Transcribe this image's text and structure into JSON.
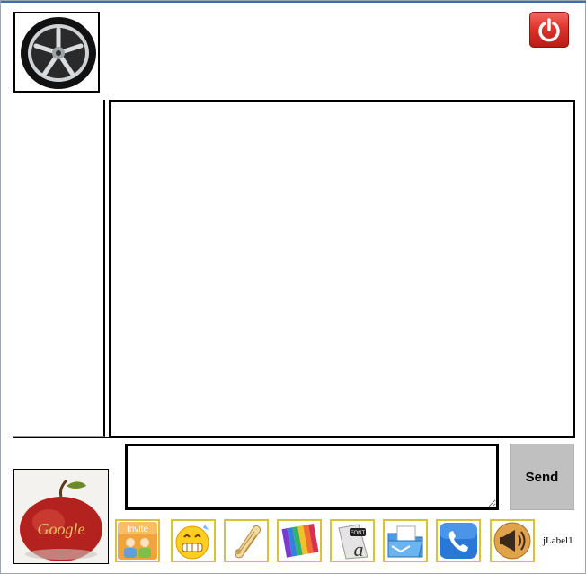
{
  "header": {
    "power_icon": "power-icon"
  },
  "compose": {
    "message_value": "",
    "send_label": "Send"
  },
  "toolbar": {
    "invite_label": "Invite",
    "font_badge": "FONT",
    "font_letter": "a",
    "icons": [
      "invite-icon",
      "emoticon-icon",
      "scroll-icon",
      "color-palette-icon",
      "font-icon",
      "folder-icon",
      "phone-icon",
      "megaphone-icon"
    ]
  },
  "status": {
    "label": "jLabel1"
  },
  "avatar_bottom": {
    "text": "Google"
  },
  "colors": {
    "send_bg": "#c0c0c0",
    "tool_border": "#d8c23a",
    "power_red": "#e0342b"
  }
}
